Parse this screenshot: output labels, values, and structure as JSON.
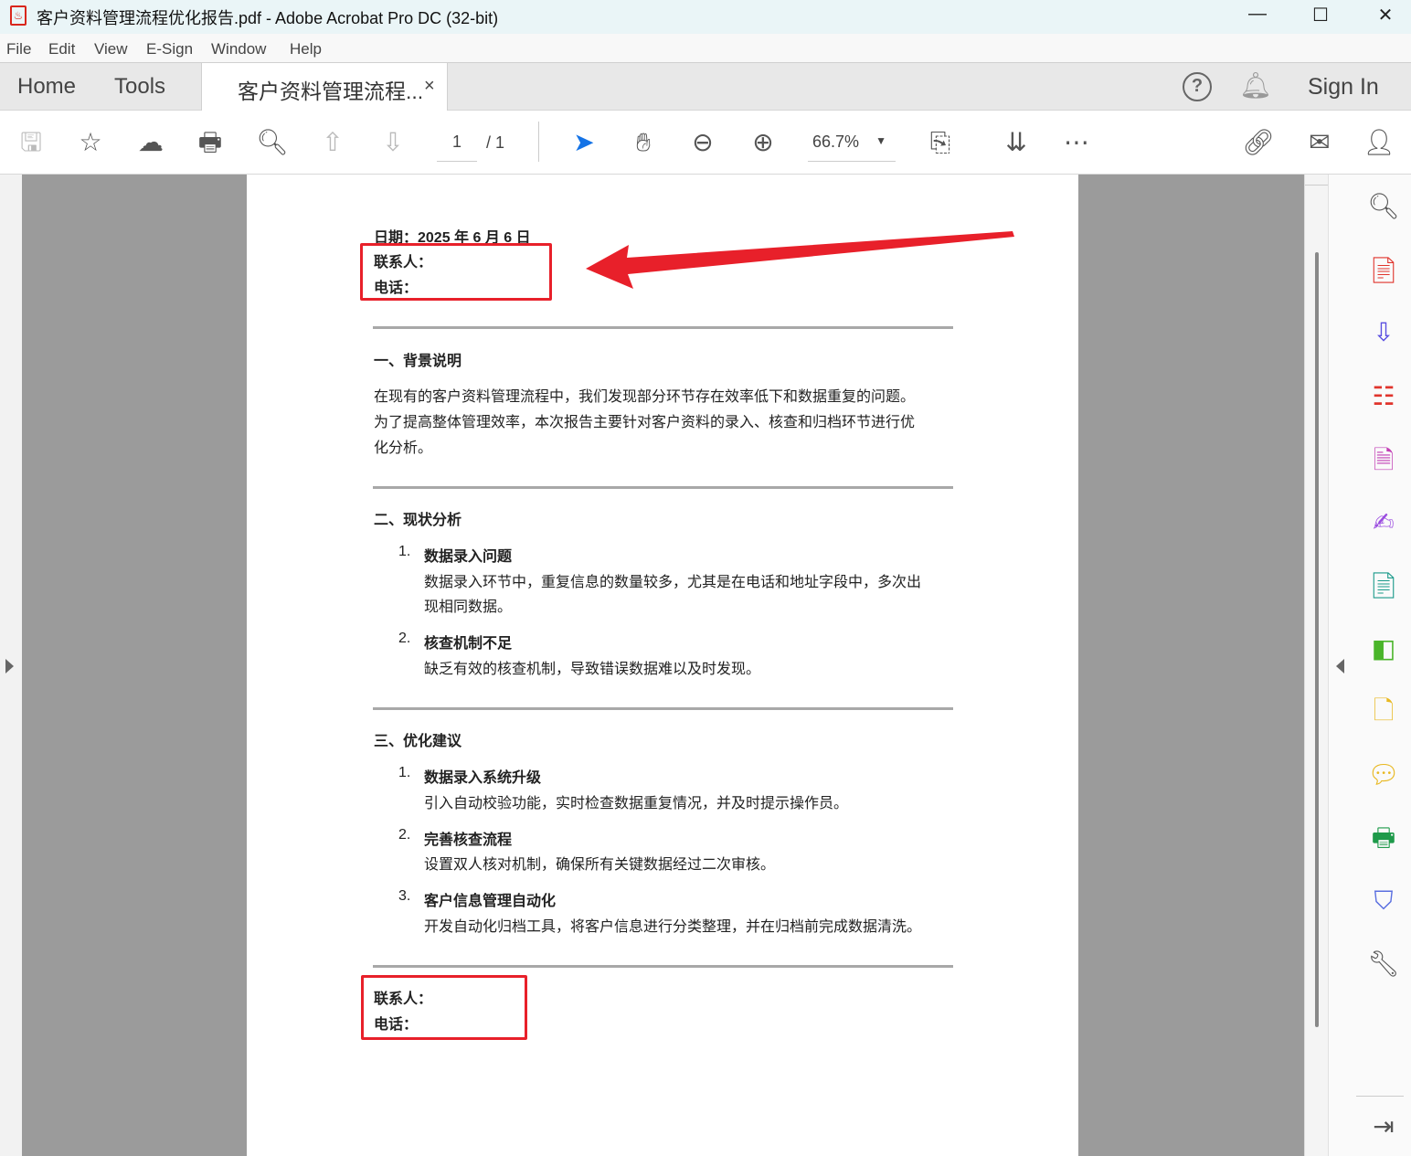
{
  "window": {
    "title": "客户资料管理流程优化报告.pdf - Adobe Acrobat Pro DC (32-bit)",
    "minimize": "—",
    "maximize": "☐",
    "close": "✕"
  },
  "menu": [
    "File",
    "Edit",
    "View",
    "E-Sign",
    "Window",
    "Help"
  ],
  "tabs": {
    "home": "Home",
    "tools": "Tools",
    "document": "客户资料管理流程...",
    "close": "×",
    "sign_in": "Sign In"
  },
  "toolbar": {
    "page_current": "1",
    "page_total": "/ 1",
    "zoom": "66.7%"
  },
  "document": {
    "date": "日期：2025 年 6 月 6 日",
    "contact": "联系人：",
    "phone": "电话：",
    "s1_title": "一、背景说明",
    "s1_lines": [
      "在现有的客户资料管理流程中，我们发现部分环节存在效率低下和数据重复的问题。",
      "为了提高整体管理效率，本次报告主要针对客户资料的录入、核查和归档环节进行优",
      "化分析。"
    ],
    "s2_title": "二、现状分析",
    "s2_items": [
      {
        "num": "1.",
        "title": "数据录入问题",
        "lines": [
          "数据录入环节中，重复信息的数量较多，尤其是在电话和地址字段中，多次出",
          "现相同数据。"
        ]
      },
      {
        "num": "2.",
        "title": "核查机制不足",
        "lines": [
          "缺乏有效的核查机制，导致错误数据难以及时发现。"
        ]
      }
    ],
    "s3_title": "三、优化建议",
    "s3_items": [
      {
        "num": "1.",
        "title": "数据录入系统升级",
        "lines": [
          "引入自动校验功能，实时检查数据重复情况，并及时提示操作员。"
        ]
      },
      {
        "num": "2.",
        "title": "完善核查流程",
        "lines": [
          "设置双人核对机制，确保所有关键数据经过二次审核。"
        ]
      },
      {
        "num": "3.",
        "title": "客户信息管理自动化",
        "lines": [
          "开发自动化归档工具，将客户信息进行分类整理，并在归档前完成数据清洗。"
        ]
      }
    ],
    "footer_contact": "联系人：",
    "footer_phone": "电话："
  },
  "colors": {
    "annotation": "#e8202a",
    "accent": "#1473e6"
  }
}
